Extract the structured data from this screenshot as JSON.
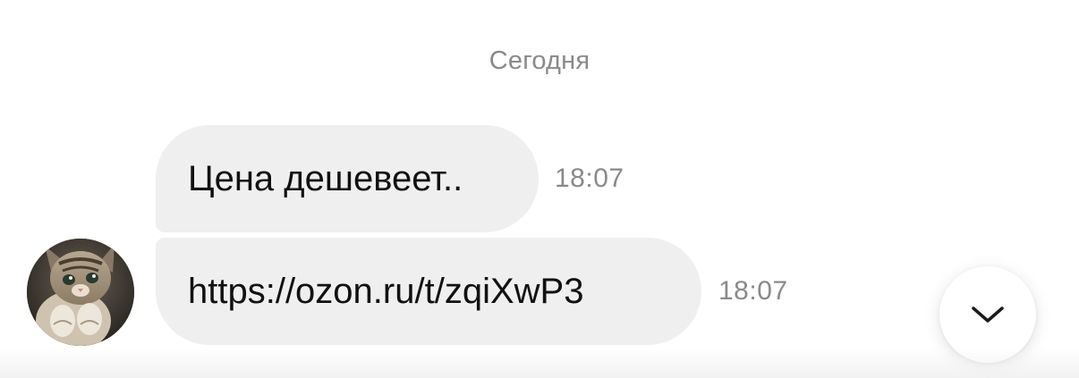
{
  "chat": {
    "date_divider": "Сегодня",
    "messages": [
      {
        "text": "Цена дешевеет..",
        "time": "18:07"
      },
      {
        "text": "https://ozon.ru/t/zqiXwP3",
        "time": "18:07"
      }
    ],
    "avatar_icon": "kitten-avatar",
    "scroll_button_icon": "chevron-down-icon"
  },
  "colors": {
    "bubble_bg": "#efeff0",
    "meta_text": "#8a8a8a",
    "text": "#111111",
    "background": "#ffffff"
  }
}
